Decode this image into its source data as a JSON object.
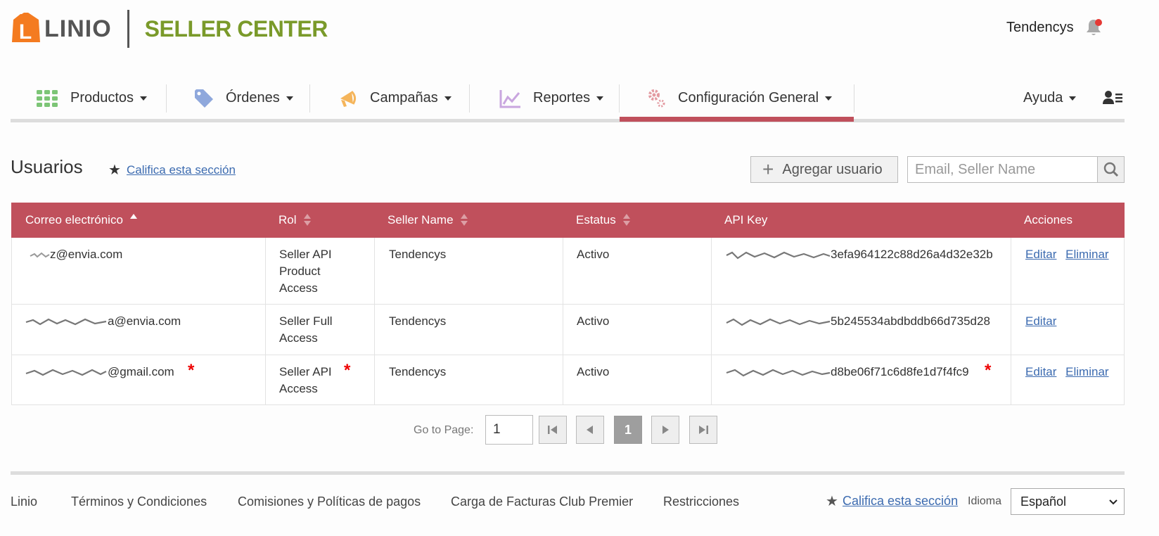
{
  "header": {
    "logo_text": "LINIO",
    "seller_center": "SELLER CENTER",
    "user_name": "Tendencys"
  },
  "nav": {
    "items": [
      {
        "label": "Productos",
        "icon": "grid-icon"
      },
      {
        "label": "Órdenes",
        "icon": "tag-icon"
      },
      {
        "label": "Campañas",
        "icon": "megaphone-icon"
      },
      {
        "label": "Reportes",
        "icon": "chart-icon"
      },
      {
        "label": "Configuración General",
        "icon": "gears-icon"
      }
    ],
    "help_label": "Ayuda",
    "active_index": 4,
    "accent_color": "#c0505c"
  },
  "page": {
    "title": "Usuarios",
    "rate_link": "Califica esta sección",
    "add_button": "Agregar usuario",
    "search_placeholder": "Email, Seller Name"
  },
  "table": {
    "headers": [
      "Correo electrónico",
      "Rol",
      "Seller Name",
      "Estatus",
      "API Key",
      "Acciones"
    ],
    "rows": [
      {
        "email": "z@envia.com",
        "role": [
          "Seller API",
          "Product",
          "Access"
        ],
        "seller": "Tendencys",
        "status": "Activo",
        "api_key": "3efa964122c88d26a4d32e32b",
        "actions": [
          "Editar",
          "Eliminar"
        ]
      },
      {
        "email": "a@envia.com",
        "role": [
          "Seller Full",
          "Access"
        ],
        "seller": "Tendencys",
        "status": "Activo",
        "api_key": "5b245534abdbddb66d735d28",
        "actions": [
          "Editar"
        ]
      },
      {
        "email": "@gmail.com",
        "role": [
          "Seller API",
          "Access"
        ],
        "seller": "Tendencys",
        "status": "Activo",
        "api_key": "d8be06f71c6d8fe1d7f4fc9",
        "actions": [
          "Editar",
          "Eliminar"
        ]
      }
    ]
  },
  "pagination": {
    "label": "Go to Page:",
    "value": "1",
    "current": "1"
  },
  "footer": {
    "links": [
      "Linio",
      "Términos y Condiciones",
      "Comisiones y Políticas de pagos",
      "Carga de Facturas Club Premier",
      "Restricciones"
    ],
    "rate_link": "Califica esta sección",
    "language_label": "Idioma",
    "language_value": "Español"
  }
}
